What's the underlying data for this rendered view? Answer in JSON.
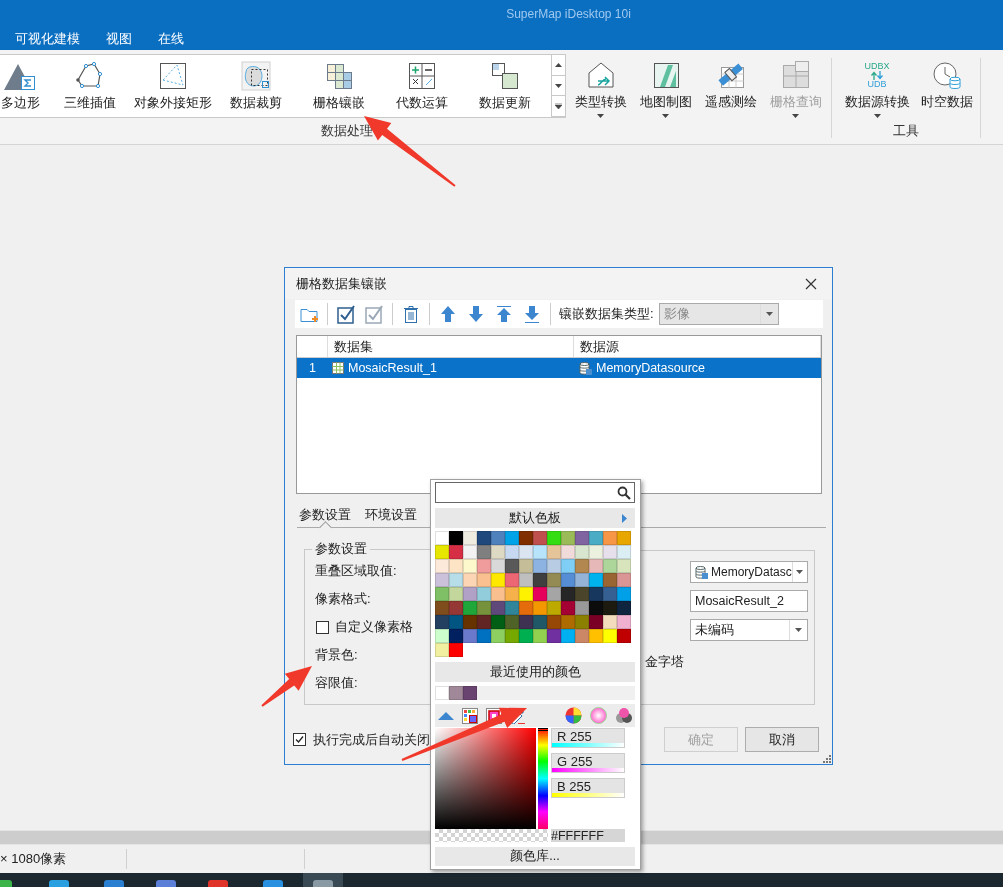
{
  "window": {
    "title": "SuperMap iDesktop 10i"
  },
  "menu_tabs": [
    {
      "label": "可视化建模",
      "selected": false
    },
    {
      "label": "视图",
      "selected": false
    },
    {
      "label": "在线",
      "selected": false
    }
  ],
  "ribbon": {
    "groups": [
      {
        "kind": "gallery",
        "label": "数据处理",
        "items": [
          {
            "label": "多边形",
            "dropdown": false,
            "disabled": false
          },
          {
            "label": "三维插值",
            "dropdown": false,
            "disabled": false
          },
          {
            "label": "对象外接矩形",
            "dropdown": false,
            "disabled": false
          },
          {
            "label": "数据裁剪",
            "dropdown": false,
            "disabled": false
          },
          {
            "label": "栅格镶嵌",
            "dropdown": false,
            "disabled": false
          },
          {
            "label": "代数运算",
            "dropdown": false,
            "disabled": false
          },
          {
            "label": "数据更新",
            "dropdown": false,
            "disabled": false
          }
        ]
      },
      {
        "kind": "buttons",
        "items": [
          {
            "label": "类型转换",
            "dropdown": true,
            "disabled": false
          },
          {
            "label": "地图制图",
            "dropdown": true,
            "disabled": false
          },
          {
            "label": "遥感测绘",
            "dropdown": false,
            "disabled": false
          },
          {
            "label": "栅格查询",
            "dropdown": true,
            "disabled": true
          }
        ]
      },
      {
        "kind": "buttons",
        "label": "工具",
        "items": [
          {
            "label": "数据源转换",
            "dropdown": true,
            "disabled": false,
            "icon_texts": [
              "UDBX",
              "UDB"
            ]
          },
          {
            "label": "时空数据",
            "dropdown": false,
            "disabled": false
          }
        ]
      }
    ]
  },
  "dialog": {
    "title": "栅格数据集镶嵌",
    "mosaic_type": {
      "label": "镶嵌数据集类型:",
      "value": "影像",
      "disabled": true
    },
    "table": {
      "columns": [
        "数据集",
        "数据源"
      ],
      "rows": [
        {
          "number": "1",
          "dataset": "MosaicResult_1",
          "datasource": "MemoryDatasource",
          "selected": true
        }
      ]
    },
    "tabs": [
      {
        "label": "参数设置",
        "selected": true
      },
      {
        "label": "环境设置",
        "selected": false
      }
    ],
    "parameters": {
      "title": "参数设置",
      "rows": [
        {
          "kind": "label",
          "text": "重叠区域取值:"
        },
        {
          "kind": "label",
          "text": "像素格式:"
        },
        {
          "kind": "checkbox",
          "text": "自定义像素格",
          "checked": false
        },
        {
          "kind": "label",
          "text": "背景色:"
        },
        {
          "kind": "label",
          "text": "容限值:"
        }
      ]
    },
    "result": {
      "datasource": "MemoryDatasc",
      "dataset": "MosaicResult_2",
      "encoding": "未编码",
      "pyramid": "金字塔"
    },
    "auto_close": {
      "label": "执行完成后自动关闭",
      "checked": true
    },
    "buttons": [
      {
        "label": "确定",
        "disabled": true
      },
      {
        "label": "取消",
        "disabled": false
      }
    ]
  },
  "color_popup": {
    "palette_title": "默认色板",
    "palette": [
      [
        {
          "color": "#ffffff"
        },
        {
          "color": "#000000"
        },
        {
          "color": "#eeece1"
        },
        {
          "color": "#1f497d"
        },
        {
          "color": "#4f81bd"
        },
        {
          "color": "#00a2e8"
        },
        {
          "color": "#7f2f00"
        },
        {
          "color": "#c0504d"
        },
        {
          "color": "#33dd11"
        },
        {
          "color": "#9bbb59"
        },
        {
          "color": "#8064a2"
        },
        {
          "color": "#4bacc6"
        },
        {
          "color": "#f79646"
        },
        {
          "color": "#e8a600"
        }
      ],
      [
        {
          "color": "#e6e600"
        },
        {
          "color": "#d62f45"
        },
        {
          "color": "#f2f2f2"
        },
        {
          "color": "#7f7f7f"
        },
        {
          "color": "#ddd9c3"
        },
        {
          "color": "#c6d9f0"
        },
        {
          "color": "#dbe5f1"
        },
        {
          "color": "#b7e4fa"
        },
        {
          "color": "#e5c49a"
        },
        {
          "color": "#f0dada"
        },
        {
          "color": "#d8e6d0"
        },
        {
          "color": "#ebf1de"
        },
        {
          "color": "#e5e0ec"
        },
        {
          "color": "#dbeef3"
        }
      ],
      [
        {
          "color": "#fde9d9"
        },
        {
          "color": "#fde4c4"
        },
        {
          "color": "#fef9cc"
        },
        {
          "color": "#f19c9c"
        },
        {
          "color": "#d9d9d9"
        },
        {
          "color": "#595959"
        },
        {
          "color": "#c4bd97"
        },
        {
          "color": "#8db3e2"
        },
        {
          "color": "#b8cce4"
        },
        {
          "color": "#7fcef5"
        },
        {
          "color": "#b28850"
        },
        {
          "color": "#e6b9b8"
        },
        {
          "color": "#add79a"
        },
        {
          "color": "#d7e4bc"
        }
      ],
      [
        {
          "color": "#ccc1da"
        },
        {
          "color": "#b7dde8"
        },
        {
          "color": "#fcd5b4"
        },
        {
          "color": "#fac090"
        },
        {
          "color": "#ffe800"
        },
        {
          "color": "#ec6674"
        },
        {
          "color": "#bfbfbf"
        },
        {
          "color": "#3f3f3f"
        },
        {
          "color": "#948a54"
        },
        {
          "color": "#558ed5"
        },
        {
          "color": "#95b3d7"
        },
        {
          "color": "#00b2ee"
        },
        {
          "color": "#996633"
        },
        {
          "color": "#d99694"
        }
      ],
      [
        {
          "color": "#7fc066"
        },
        {
          "color": "#c3d69b"
        },
        {
          "color": "#b2a1c7"
        },
        {
          "color": "#92cddc"
        },
        {
          "color": "#fabf8f"
        },
        {
          "color": "#f6b14a"
        },
        {
          "color": "#fff200"
        },
        {
          "color": "#e6005c"
        },
        {
          "color": "#a5a5a5"
        },
        {
          "color": "#262626"
        },
        {
          "color": "#4a452a"
        },
        {
          "color": "#17375e"
        },
        {
          "color": "#366092"
        },
        {
          "color": "#00a0e9"
        }
      ],
      [
        {
          "color": "#7f4c1b"
        },
        {
          "color": "#953735"
        },
        {
          "color": "#20a73a"
        },
        {
          "color": "#76923c"
        },
        {
          "color": "#5f497a"
        },
        {
          "color": "#31859b"
        },
        {
          "color": "#e46c0a"
        },
        {
          "color": "#f39800"
        },
        {
          "color": "#bcaa00"
        },
        {
          "color": "#a50034"
        },
        {
          "color": "#999999"
        },
        {
          "color": "#0c0c0c"
        },
        {
          "color": "#1d1b10"
        },
        {
          "color": "#0f243e"
        }
      ],
      [
        {
          "color": "#244061"
        },
        {
          "color": "#005583"
        },
        {
          "color": "#663300"
        },
        {
          "color": "#632523"
        },
        {
          "color": "#005e15"
        },
        {
          "color": "#4f6228"
        },
        {
          "color": "#3f3151"
        },
        {
          "color": "#215867"
        },
        {
          "color": "#974806"
        },
        {
          "color": "#ae6c00"
        },
        {
          "color": "#8c8000"
        },
        {
          "color": "#7b0025"
        },
        {
          "color": "#f2dcbb"
        },
        {
          "color": "#f0b0d0"
        }
      ],
      [
        {
          "color": "#ccffcc"
        },
        {
          "color": "#002060"
        },
        {
          "color": "#6a79cc"
        },
        {
          "color": "#0070c0"
        },
        {
          "color": "#8ecf62"
        },
        {
          "color": "#77a800"
        },
        {
          "color": "#00b050"
        },
        {
          "color": "#92d050"
        },
        {
          "color": "#7030a0"
        },
        {
          "color": "#00b0f0"
        },
        {
          "color": "#cc8866"
        },
        {
          "color": "#ffc000"
        },
        {
          "color": "#ffff00"
        },
        {
          "color": "#c00000"
        }
      ],
      [
        {
          "color": "#f0f0a0"
        },
        {
          "color": "#ff0000"
        }
      ]
    ],
    "recent_title": "最近使用的颜色",
    "recent": [
      {
        "color": "#ffffff"
      },
      {
        "color": "#a08898"
      },
      {
        "color": "#6a4470"
      }
    ],
    "channels": [
      {
        "text": "R 255"
      },
      {
        "text": "G 255"
      },
      {
        "text": "B 255"
      }
    ],
    "hue": {
      "level": 0
    },
    "hex": "#FFFFFF",
    "library_button": "颜色库..."
  },
  "status_bar": {
    "text": "× 1080像素"
  }
}
